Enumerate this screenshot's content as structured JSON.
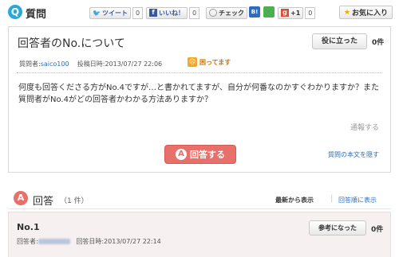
{
  "header": {
    "badge": "Q",
    "title": "質問",
    "share": {
      "tweet_label": "ツイート",
      "tweet_count": "0",
      "like_label": "いいね！",
      "like_count": "0",
      "check_label": "チェック",
      "hatena_label": "B!",
      "gplus_label": "+1",
      "gplus_count": "0"
    },
    "favorite_label": "お気に入り"
  },
  "question": {
    "title": "回答者のNo.について",
    "useful_label": "役に立った",
    "useful_count": "0件",
    "asker_label": "質問者:",
    "asker_name": "saico100",
    "posted_label": "投稿日時:",
    "posted_at": "2013/07/27 22:06",
    "status": "困ってます",
    "body": "何度も回答くださる方がNo.4ですが…と書かれてますが、自分が何番なのかすぐわかりますか？また質問者がNo.4がどの回答者かわかる方法ありますか？",
    "report_label": "通報する",
    "answer_button": "回答する",
    "answer_badge": "A",
    "hide_label": "質問の本文を隠す"
  },
  "answers": {
    "badge": "A",
    "title": "回答",
    "count": "（1 件）",
    "sort_newest": "最新から表示",
    "sort_separator": "|",
    "sort_order": "回答順に表示",
    "items": [
      {
        "number": "No.1",
        "answerer_label": "回答者:",
        "posted_label": "回答日時:",
        "posted_at": "2013/07/27 22:14",
        "ref_label": "参考になった",
        "ref_count": "0件"
      }
    ]
  },
  "colors": {
    "accent_blue": "#2aa8d8",
    "answer_red": "#e8706a",
    "link_blue": "#2a6ebb",
    "status_orange": "#f5a623"
  }
}
